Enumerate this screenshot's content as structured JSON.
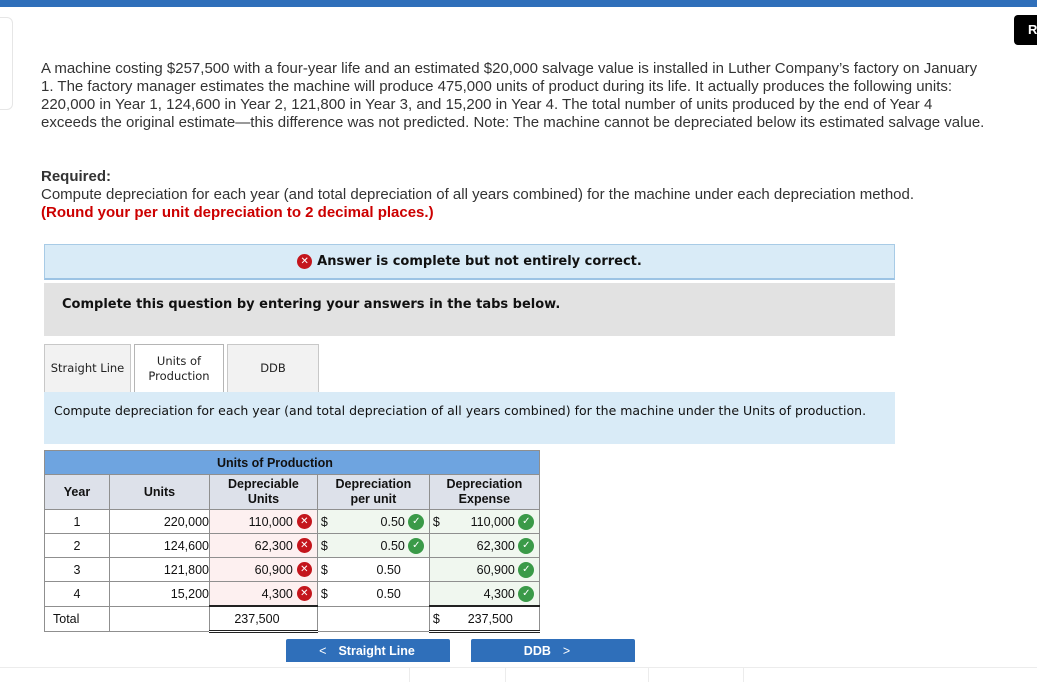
{
  "top_button_label": "R",
  "problem_text": "A machine costing $257,500 with a four-year life and an estimated $20,000 salvage value is installed in Luther Company’s factory on January 1. The factory manager estimates the machine will produce 475,000 units of product during its life. It actually produces the following units: 220,000 in Year 1, 124,600 in Year 2, 121,800 in Year 3, and 15,200 in Year 4. The total number of units produced by the end of Year 4 exceeds the original estimate—this difference was not predicted. Note: The machine cannot be depreciated below its estimated salvage value.",
  "required": {
    "heading": "Required:",
    "text": "Compute depreciation for each year (and total depreciation of all years combined) for the machine under each depreciation method.",
    "note": "(Round your per unit depreciation to 2 decimal places.)"
  },
  "banner": {
    "icon": "x-circle-icon",
    "text": "Answer is complete but not entirely correct."
  },
  "instructions": "Complete this question by entering your answers in the tabs below.",
  "tabs": [
    {
      "label": "Straight Line",
      "active": false
    },
    {
      "label": "Units of Production",
      "active": true
    },
    {
      "label": "DDB",
      "active": false
    }
  ],
  "tab_description": "Compute depreciation for each year (and total depreciation of all years combined) for the machine under the Units of production.",
  "table": {
    "group_header": "Units of Production",
    "headers": {
      "year": "Year",
      "units": "Units",
      "depreciable_units": "Depreciable Units",
      "dep_per_unit": "Depreciation per unit",
      "dep_expense": "Depreciation Expense"
    },
    "currency": "$",
    "rows": [
      {
        "year": "1",
        "units": "220,000",
        "depreciable_units": "110,000",
        "dep_units_status": "incorrect",
        "per_unit": "0.50",
        "per_unit_status": "correct",
        "expense": "110,000",
        "expense_status": "correct",
        "show_per_unit_dollar": true,
        "show_expense_dollar": true
      },
      {
        "year": "2",
        "units": "124,600",
        "depreciable_units": "62,300",
        "dep_units_status": "incorrect",
        "per_unit": "0.50",
        "per_unit_status": "correct",
        "expense": "62,300",
        "expense_status": "correct",
        "show_per_unit_dollar": true,
        "show_expense_dollar": false
      },
      {
        "year": "3",
        "units": "121,800",
        "depreciable_units": "60,900",
        "dep_units_status": "incorrect",
        "per_unit": "0.50",
        "per_unit_status": "none",
        "expense": "60,900",
        "expense_status": "correct",
        "show_per_unit_dollar": true,
        "show_expense_dollar": false
      },
      {
        "year": "4",
        "units": "15,200",
        "depreciable_units": "4,300",
        "dep_units_status": "incorrect",
        "per_unit": "0.50",
        "per_unit_status": "none",
        "expense": "4,300",
        "expense_status": "correct",
        "show_per_unit_dollar": true,
        "show_expense_dollar": false
      }
    ],
    "total": {
      "label": "Total",
      "depreciable_units": "237,500",
      "expense": "237,500"
    }
  },
  "nav": {
    "prev_label": "Straight Line",
    "next_label": "DDB",
    "prev_icon": "chevron-left-icon",
    "next_icon": "chevron-right-icon"
  },
  "colors": {
    "brand_blue": "#2f6fba",
    "error_red": "#c4151c",
    "success_green": "#3a9a48",
    "note_red": "#cc0000"
  }
}
